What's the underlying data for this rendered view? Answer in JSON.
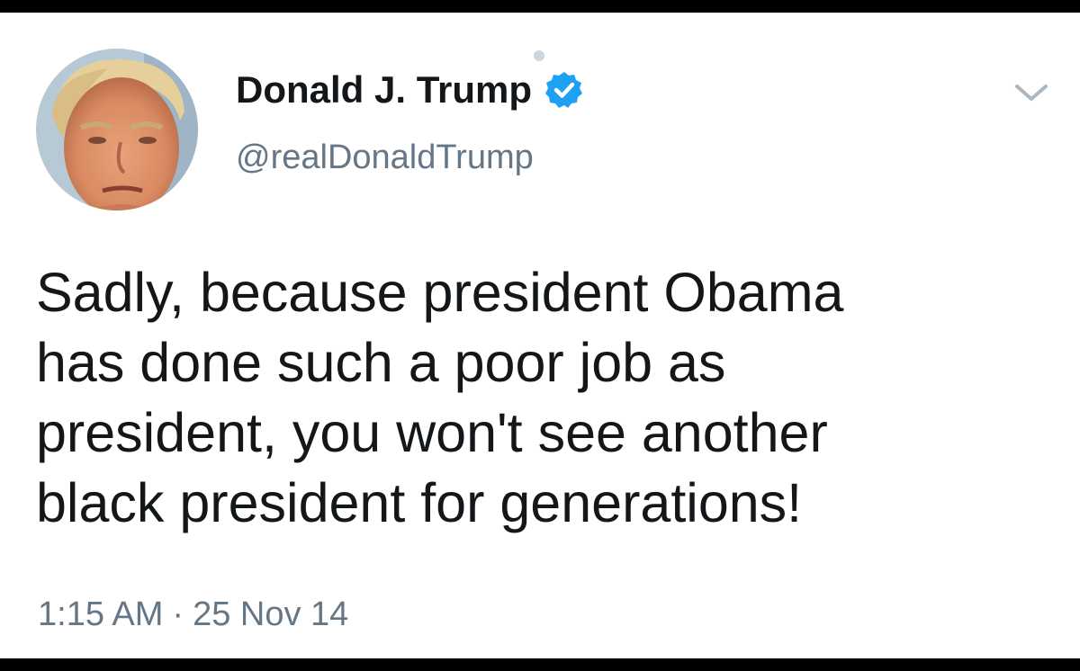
{
  "tweet": {
    "author": {
      "display_name": "Donald J. Trump",
      "handle": "@realDonaldTrump",
      "verified": true,
      "avatar_icon": "profile-photo",
      "verified_icon": "verified-badge-icon"
    },
    "text_lines": [
      "Sadly, because president Obama",
      "has done such a poor job as",
      "president, you won't see another",
      "black president for generations!"
    ],
    "time": "1:15 AM",
    "separator": "·",
    "date": "25 Nov 14",
    "menu_icon": "chevron-down-icon"
  },
  "colors": {
    "text": "#14171a",
    "secondary_text": "#657786",
    "verified_blue": "#1da1f2",
    "background": "#ffffff",
    "frame": "#000000"
  }
}
